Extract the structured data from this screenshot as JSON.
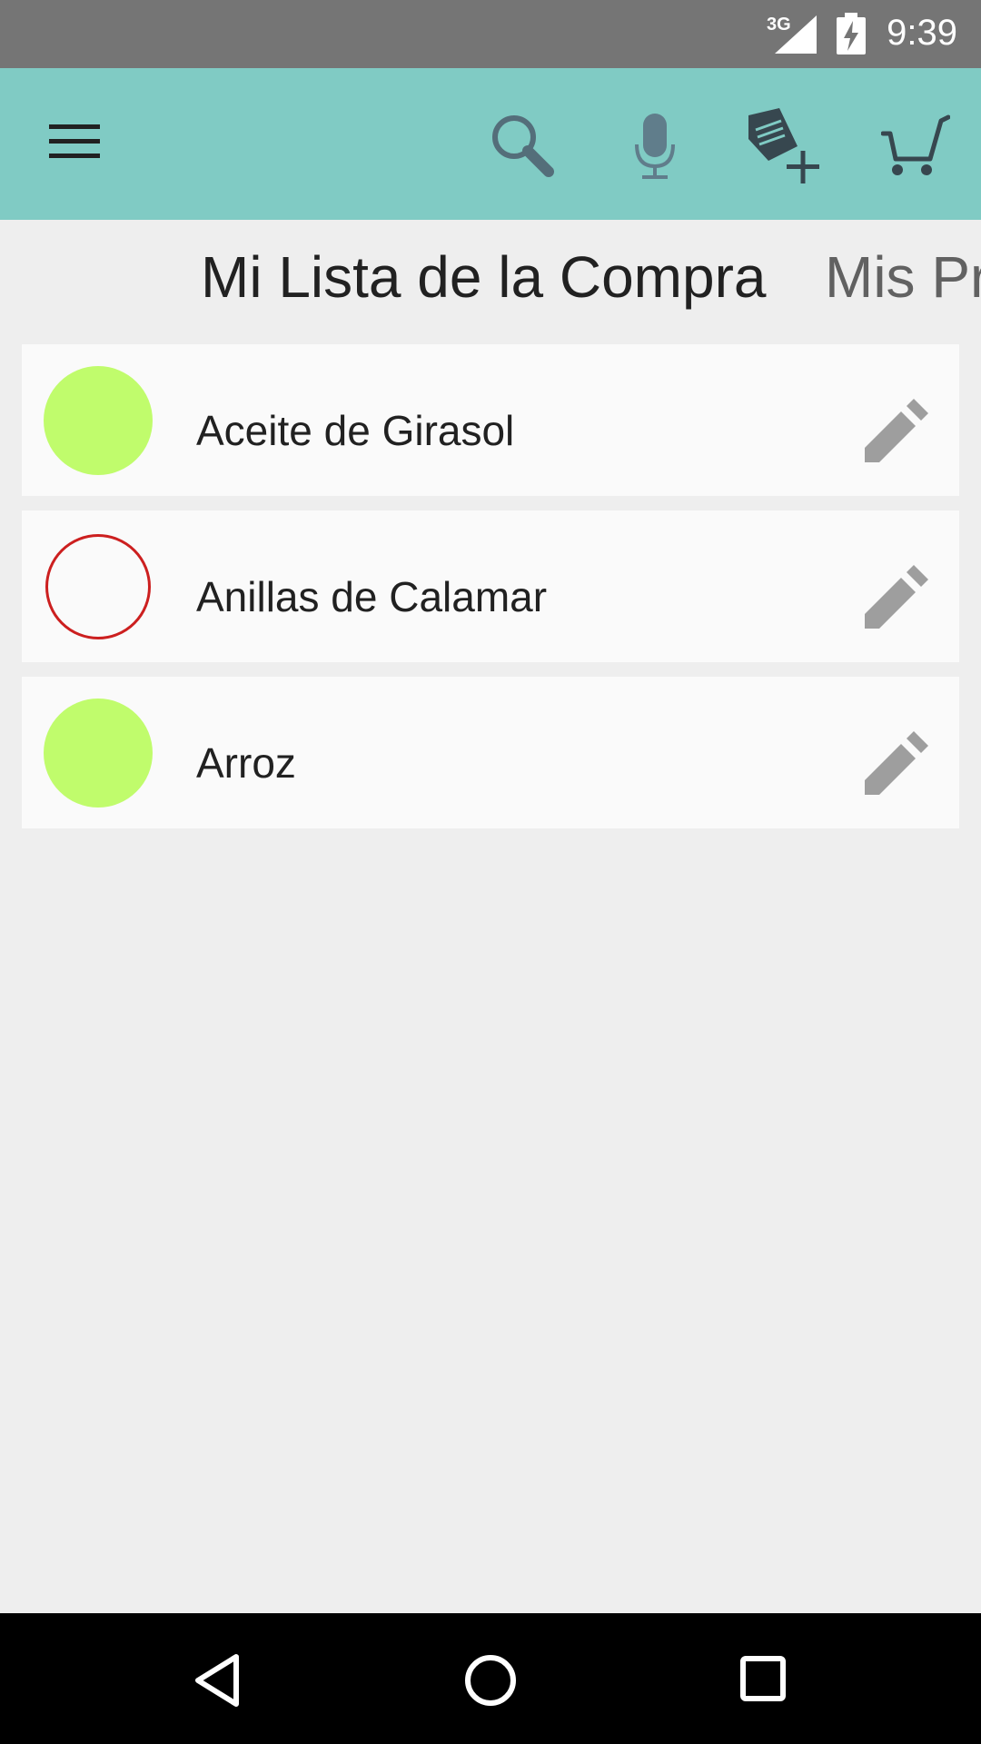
{
  "status_bar": {
    "network": "3G",
    "time": "9:39",
    "icons": [
      "signal-icon",
      "battery-charging-icon"
    ]
  },
  "toolbar": {
    "icons": [
      "menu-icon",
      "search-icon",
      "microphone-icon",
      "add-tag-icon",
      "cart-icon"
    ],
    "colors": {
      "background": "#80cbc4",
      "icon": "#37474f"
    }
  },
  "tabs": [
    {
      "label": "Mi Lista de la Compra",
      "active": true
    },
    {
      "label": "Mis Pr",
      "active": false
    }
  ],
  "items": [
    {
      "name": "Aceite de Girasol",
      "status": "checked",
      "color": "#c0fc6c"
    },
    {
      "name": "Anillas de Calamar",
      "status": "unchecked",
      "color": "#cc1f1f"
    },
    {
      "name": "Arroz",
      "status": "checked",
      "color": "#c0fc6c"
    }
  ],
  "nav_bar": {
    "icons": [
      "back-icon",
      "home-icon",
      "recents-icon"
    ]
  }
}
